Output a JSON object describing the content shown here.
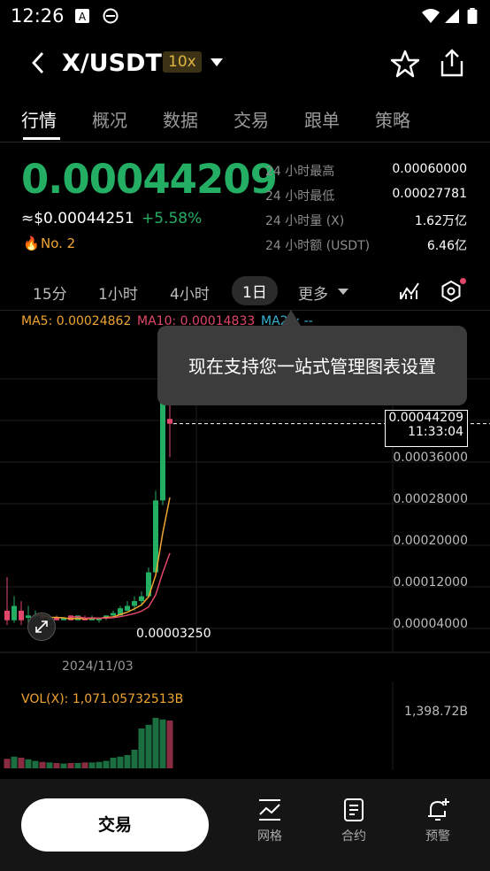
{
  "status": {
    "time": "12:26"
  },
  "header": {
    "pair": "X/USDT",
    "leverage": "10x"
  },
  "tabs": [
    "行情",
    "概况",
    "数据",
    "交易",
    "跟单",
    "策略"
  ],
  "price": {
    "last": "0.00044209",
    "usd": "≈$0.00044251",
    "change": "+5.58%",
    "rank": "No. 2"
  },
  "stats": [
    {
      "label": "24 小时最高",
      "value": "0.00060000"
    },
    {
      "label": "24 小时最低",
      "value": "0.00027781"
    },
    {
      "label": "24 小时量 (X)",
      "value": "1.62万亿"
    },
    {
      "label": "24 小时额 (USDT)",
      "value": "6.46亿"
    }
  ],
  "periods": [
    "15分",
    "1小时",
    "4小时",
    "1日",
    "更多"
  ],
  "selected_period": "1日",
  "ma": {
    "ma5": "MA5: 0.00024862",
    "ma10": "MA10: 0.00014833",
    "ma20": "MA20: --"
  },
  "tooltip": "现在支持您一站式管理图表设置",
  "current": {
    "price": "0.00044209",
    "time": "11:33:04"
  },
  "y_labels": [
    "0.00036000",
    "0.00028000",
    "0.00020000",
    "0.00012000",
    "0.00004000"
  ],
  "low_label": "0.00003250",
  "date_label": "2024/11/03",
  "volume": {
    "label": "VOL(X): 1,071.05732513B",
    "max": "1,398.72B"
  },
  "bottom": {
    "trade": "交易",
    "nav": [
      "网格",
      "合约",
      "预警"
    ]
  },
  "colors": {
    "up": "#24ae64",
    "down": "#e0476a",
    "accent": "#f0a530"
  },
  "chart_data": {
    "type": "candlestick",
    "candles": [
      {
        "o": 5e-05,
        "h": 0.00012,
        "l": 2e-05,
        "c": 3e-05
      },
      {
        "o": 3e-05,
        "h": 8e-05,
        "l": 2.5e-05,
        "c": 6e-05
      },
      {
        "o": 5e-05,
        "h": 7e-05,
        "l": 2e-05,
        "c": 3e-05
      },
      {
        "o": 3.5e-05,
        "h": 6e-05,
        "l": 2e-05,
        "c": 4e-05
      },
      {
        "o": 4e-05,
        "h": 5e-05,
        "l": 3.5e-05,
        "c": 4e-05
      },
      {
        "o": 4e-05,
        "h": 4.5e-05,
        "l": 3e-05,
        "c": 3.5e-05
      },
      {
        "o": 3.5e-05,
        "h": 4e-05,
        "l": 3e-05,
        "c": 3.5e-05
      },
      {
        "o": 3.5e-05,
        "h": 4e-05,
        "l": 3e-05,
        "c": 3e-05
      },
      {
        "o": 3e-05,
        "h": 3.5e-05,
        "l": 3.25e-05,
        "c": 3.5e-05
      },
      {
        "o": 4e-05,
        "h": 4e-05,
        "l": 3e-05,
        "c": 3e-05
      },
      {
        "o": 3e-05,
        "h": 3.5e-05,
        "l": 3.25e-05,
        "c": 4e-05
      },
      {
        "o": 3.5e-05,
        "h": 4e-05,
        "l": 3e-05,
        "c": 3e-05
      },
      {
        "o": 3e-05,
        "h": 4e-05,
        "l": 3e-05,
        "c": 3.5e-05
      },
      {
        "o": 3e-05,
        "h": 3.5e-05,
        "l": 2.5e-05,
        "c": 3.5e-05
      },
      {
        "o": 3.5e-05,
        "h": 4e-05,
        "l": 3e-05,
        "c": 4e-05
      },
      {
        "o": 4e-05,
        "h": 5e-05,
        "l": 3.5e-05,
        "c": 4.5e-05
      },
      {
        "o": 4e-05,
        "h": 6e-05,
        "l": 4e-05,
        "c": 5.5e-05
      },
      {
        "o": 5e-05,
        "h": 7e-05,
        "l": 5e-05,
        "c": 6e-05
      },
      {
        "o": 6e-05,
        "h": 8e-05,
        "l": 5e-05,
        "c": 7e-05
      },
      {
        "o": 7e-05,
        "h": 9e-05,
        "l": 6e-05,
        "c": 8e-05
      },
      {
        "o": 8e-05,
        "h": 0.00014,
        "l": 8e-05,
        "c": 0.00013
      },
      {
        "o": 0.00013,
        "h": 0.0003,
        "l": 0.00012,
        "c": 0.00028
      },
      {
        "o": 0.00028,
        "h": 0.0006,
        "l": 0.00027,
        "c": 0.0005
      },
      {
        "o": 0.00045,
        "h": 0.0005,
        "l": 0.00037,
        "c": 0.00044
      }
    ],
    "volumes": [
      18,
      22,
      20,
      17,
      14,
      12,
      11,
      10,
      9,
      10,
      10,
      11,
      11,
      12,
      14,
      20,
      22,
      25,
      35,
      75,
      82,
      95,
      92,
      90
    ],
    "vol_max": 100,
    "ylim": [
      0,
      0.0006
    ]
  }
}
